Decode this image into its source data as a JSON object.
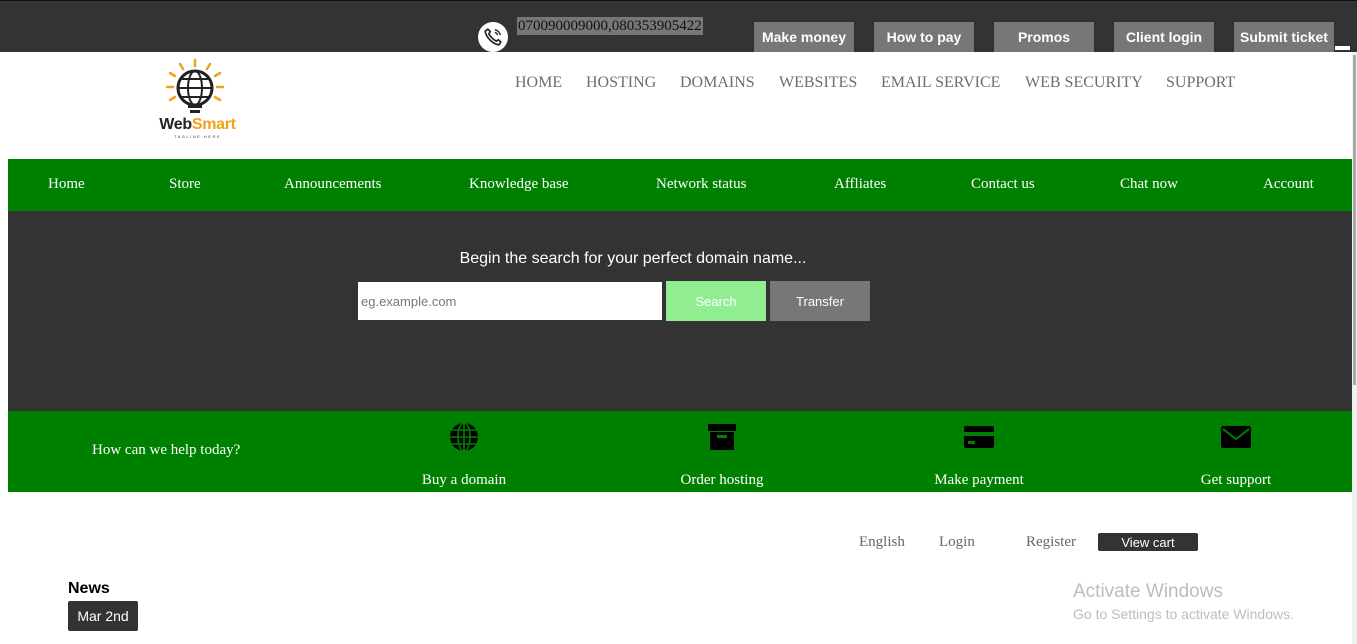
{
  "topbar": {
    "phone_icon": "phone-icon",
    "phone_numbers": "070090009000,080353905422",
    "buttons": [
      "Make money",
      "How to pay",
      "Promos",
      "Client login",
      "Submit ticket"
    ]
  },
  "logo": {
    "brand_a": "Web",
    "brand_b": "Smart",
    "tagline": "TAGLINE HERE",
    "icon": "globe-bulb-icon"
  },
  "main_nav": [
    "HOME",
    "HOSTING",
    "DOMAINS",
    "WEBSITES",
    "EMAIL SERVICE",
    "WEB SECURITY",
    "SUPPORT"
  ],
  "green_nav": [
    "Home",
    "Store",
    "Announcements",
    "Knowledge base",
    "Network status",
    "Affliates",
    "Contact us",
    "Chat now",
    "Account"
  ],
  "hero": {
    "title": "Begin the search for your perfect domain name...",
    "domain_placeholder": "eg.example.com",
    "search_label": "Search",
    "transfer_label": "Transfer"
  },
  "help": {
    "title": "How can we help today?",
    "items": [
      {
        "label": "Buy a domain",
        "icon": "globe-icon"
      },
      {
        "label": "Order hosting",
        "icon": "archive-box-icon"
      },
      {
        "label": "Make payment",
        "icon": "credit-card-icon"
      },
      {
        "label": "Get support",
        "icon": "envelope-icon"
      }
    ]
  },
  "utility": {
    "language": "English",
    "login": "Login",
    "register": "Register",
    "view_cart": "View cart"
  },
  "news": {
    "heading": "News",
    "date": "Mar 2nd"
  },
  "watermark": {
    "title": "Activate Windows",
    "subtitle": "Go to Settings to activate Windows."
  },
  "colors": {
    "topbar": "#333333",
    "brand_green": "#008000",
    "search_button": "#90ee90",
    "gray_button": "#777777",
    "logo_accent": "#f0a11c"
  }
}
